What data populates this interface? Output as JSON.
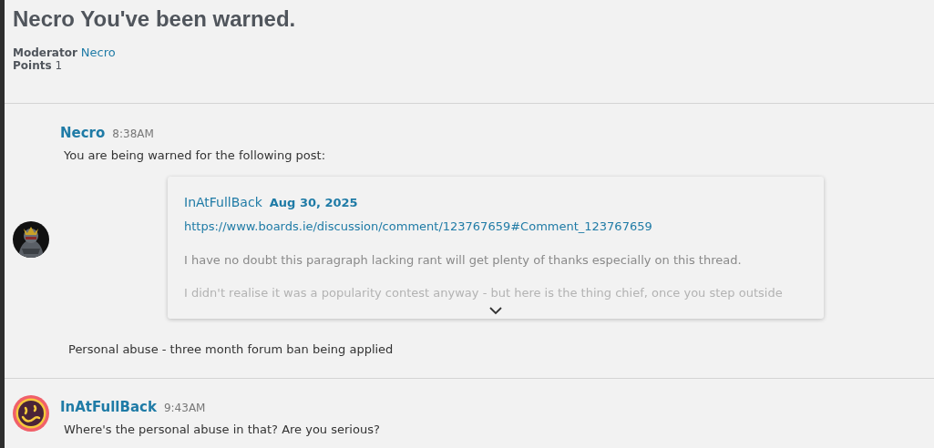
{
  "title": "Necro You've been warned.",
  "meta": [
    {
      "label": "Moderator",
      "value": "Necro",
      "kind": "link"
    },
    {
      "label": "Points",
      "value": "1",
      "kind": "text"
    }
  ],
  "messages": [
    {
      "author": "Necro",
      "time": "8:38AM",
      "body": "You are being warned for the following post:",
      "quote": {
        "author": "InAtFullBack",
        "date": "Aug 30, 2025",
        "url": "https://www.boards.ie/discussion/comment/123767659#Comment_123767659",
        "paragraphs": [
          "I have no doubt this paragraph lacking rant will get plenty of thanks especially on this thread.",
          "I didn't realise it was a popularity contest anyway - but here is the thing chief, once you step outside"
        ],
        "expanded": false
      },
      "footer": "Personal abuse - three month forum ban being applied"
    },
    {
      "author": "InAtFullBack",
      "time": "9:43AM",
      "avatar": {
        "kind": "icon"
      },
      "body": "Where's the personal abuse in that? Are you serious?"
    }
  ]
}
